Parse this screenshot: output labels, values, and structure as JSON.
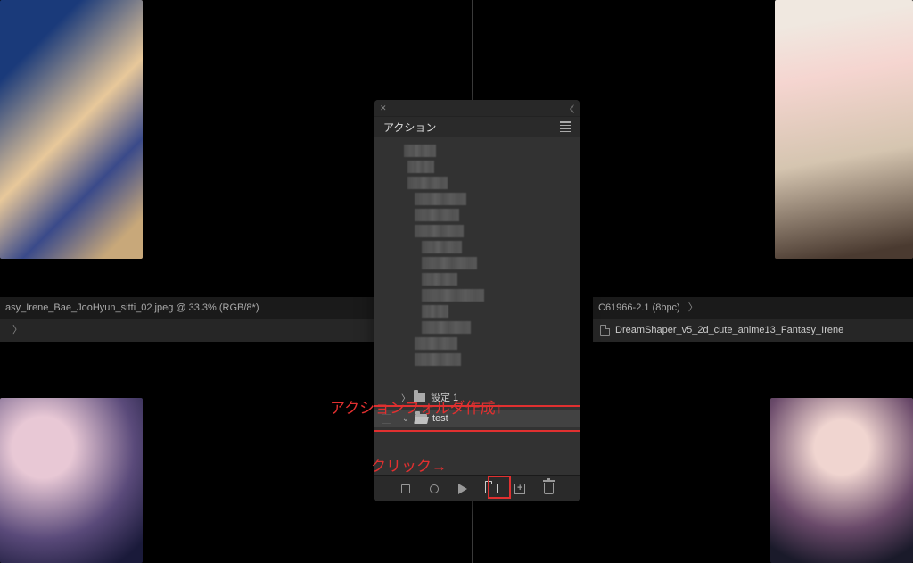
{
  "images": {
    "top_left": "anime character with blue hair",
    "top_right": "anime character with pink hair",
    "bottom_left": "anime character with pink hair and glasses",
    "bottom_right": "anime character with pink hair and glasses"
  },
  "left_tab": {
    "title": "asy_Irene_Bae_JooHyun_sitti_02.jpeg @ 33.3% (RGB/8*)",
    "breadcrumb_sep": "〉"
  },
  "right_tab": {
    "info": "C61966-2.1 (8bpc)",
    "sep": "〉",
    "filename": "DreamShaper_v5_2d_cute_anime13_Fantasy_Irene"
  },
  "panel": {
    "title": "アクション",
    "close_glyph": "✕",
    "collapse_glyph": "《",
    "rows": {
      "settei": {
        "chevron": "〉",
        "label": "設定 1"
      },
      "test": {
        "chevron": "⌄",
        "label": "test"
      }
    },
    "footer": {
      "stop": "stop",
      "record": "record",
      "play": "play",
      "newfolder": "new-folder",
      "newaction": "new-action",
      "trash": "delete"
    }
  },
  "annotations": {
    "folder_label": "アクションフォルダ作成↑",
    "click_label": "クリック→"
  },
  "colors": {
    "highlight": "#e03030"
  }
}
